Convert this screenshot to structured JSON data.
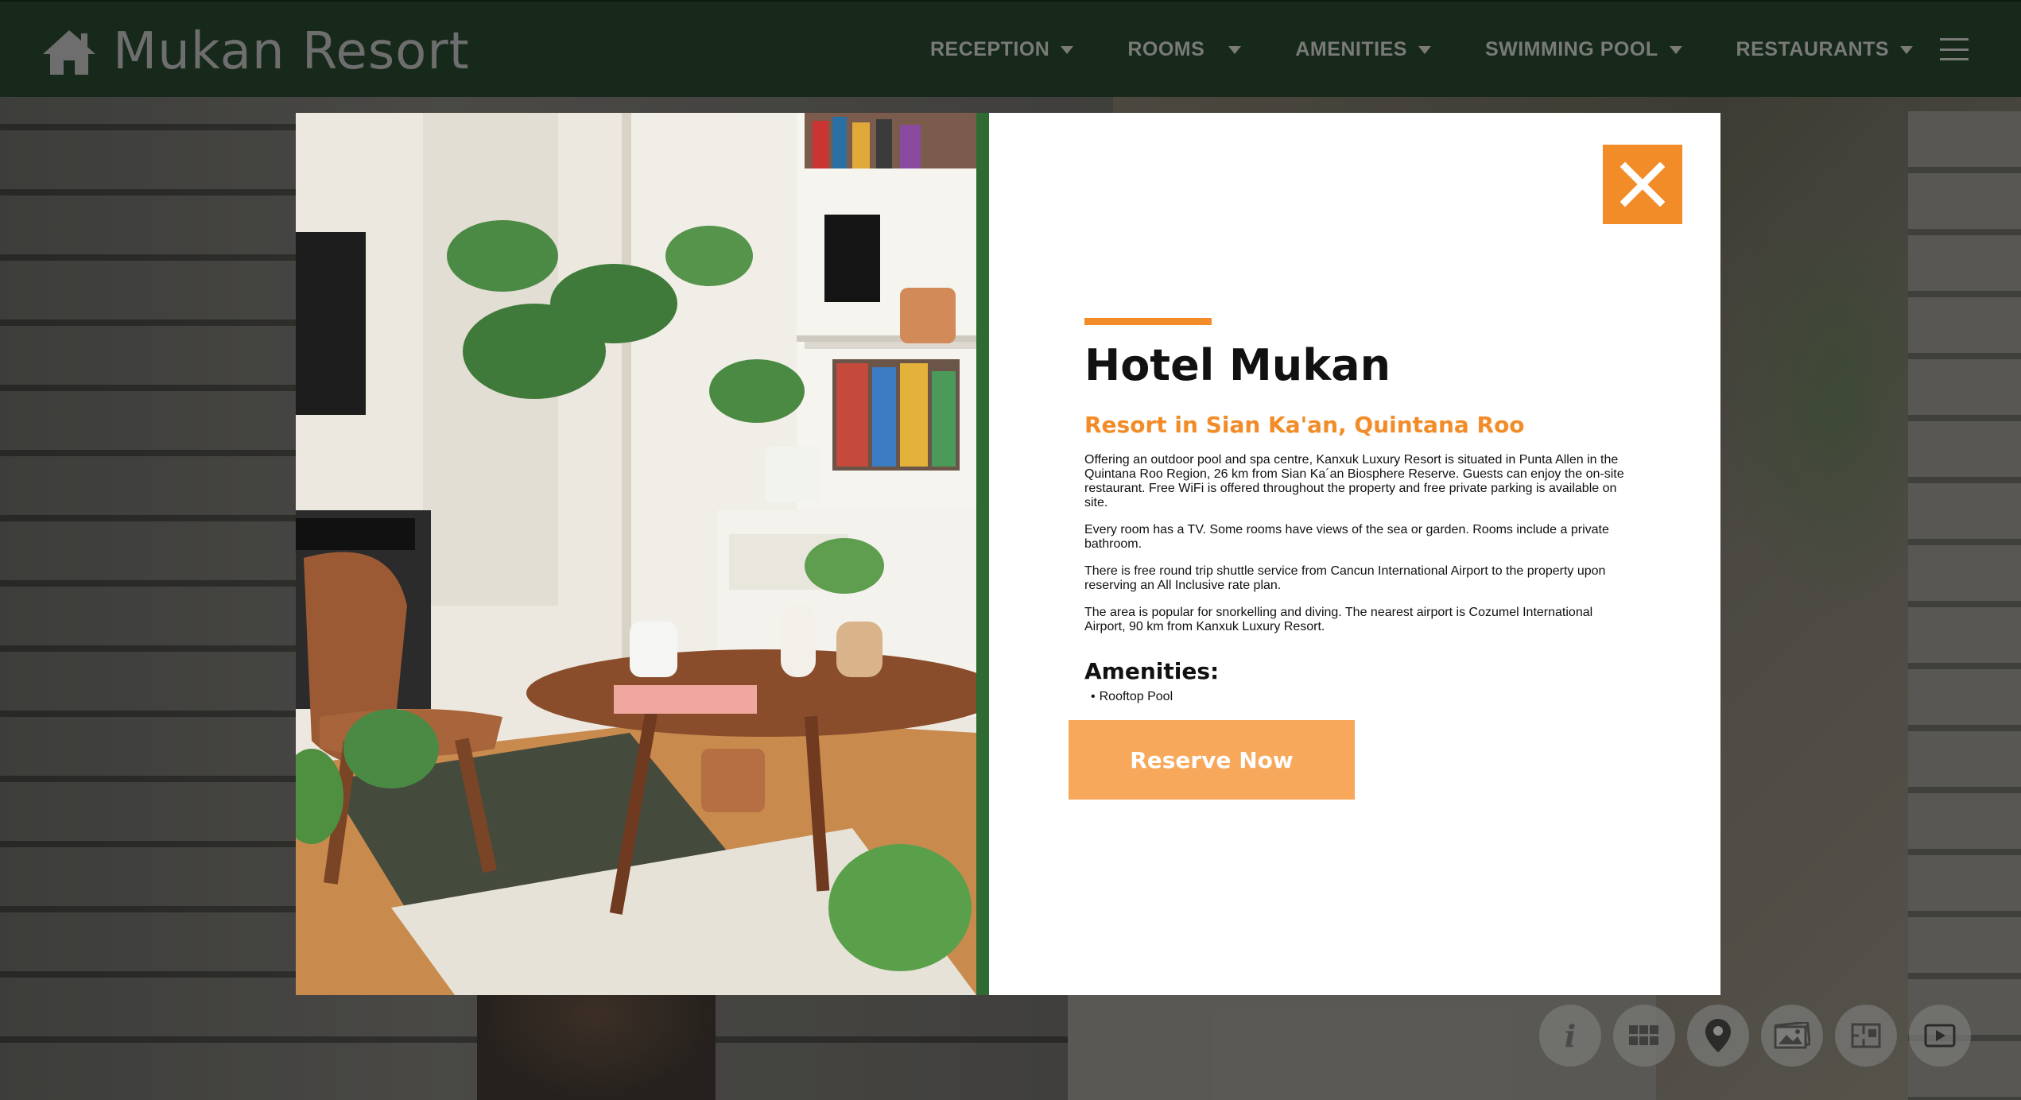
{
  "header": {
    "logo_icon": "home-icon",
    "site_name": "Mukan Resort",
    "nav": [
      {
        "label": "RECEPTION"
      },
      {
        "label": "ROOMS"
      },
      {
        "label": "AMENITIES"
      },
      {
        "label": "SWIMMING POOL"
      },
      {
        "label": "RESTAURANTS"
      }
    ],
    "menu_icon": "hamburger-menu-icon"
  },
  "modal": {
    "image_icon": "room-photo",
    "close_icon": "close-icon",
    "title": "Hotel Mukan",
    "subtitle": "Resort in Sian Ka'an, Quintana Roo",
    "paragraphs": [
      "Offering an outdoor pool and spa centre, Kanxuk Luxury Resort is situated in Punta Allen in the Quintana Roo Region, 26 km from Sian Ka´an Biosphere Reserve. Guests can enjoy the on-site restaurant. Free WiFi is offered throughout the property and free private parking is available on site.",
      "Every room has a TV. Some rooms have views of the sea or garden. Rooms include a private bathroom.",
      "There is free round trip shuttle service from Cancun International Airport to the property upon reserving an All Inclusive rate plan.",
      "The area is popular for snorkelling and diving. The nearest airport is Cozumel International Airport, 90 km from Kanxuk Luxury Resort."
    ],
    "amenities_title": "Amenities:",
    "amenities": [
      "Rooftop Pool"
    ],
    "reserve_label": "Reserve Now"
  },
  "toolbar": {
    "info_label": "i",
    "buttons": [
      "info-icon",
      "grid-icon",
      "map-pin-icon",
      "gallery-icon",
      "floorplan-icon",
      "video-icon"
    ]
  },
  "colors": {
    "header_bg": "#16291a",
    "accent": "#f28c28",
    "reserve_bg": "#f7a85a",
    "divider": "#2f6a33"
  }
}
